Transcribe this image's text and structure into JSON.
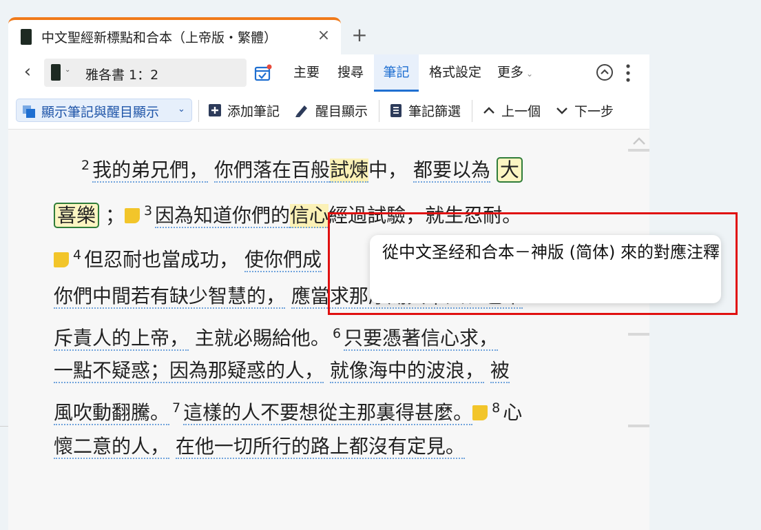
{
  "tab": {
    "title": "中文聖經新標點和合本（上帝版・繁體）",
    "close": "×",
    "new_tab": "+"
  },
  "toolbar": {
    "back": "‹",
    "reference_dropdown": "⌄",
    "reference": "雅各書 1：2",
    "menu": [
      "主要",
      "搜尋",
      "筆記",
      "格式設定",
      "更多"
    ],
    "more_chevron": "⌄",
    "active_menu": "筆記"
  },
  "subbar": {
    "show_notes": "顯示筆記與醒目顯示",
    "show_chevron": "⌄",
    "add_note": "添加筆記",
    "highlight": "醒目顯示",
    "filter": "筆記篩選",
    "prev": "上一個",
    "next": "下一步"
  },
  "verses": {
    "v2_num": "2",
    "v2_a": "我的弟兄們，",
    "v2_b": "你們落在百般",
    "v2_c": "試煉",
    "v2_d": "中，",
    "v2_e": "都要以為",
    "v2_f": "大",
    "v2_g": "喜樂",
    "v2_h": "；",
    "v3_num": "3",
    "v3_a": "因為知道你們的",
    "v3_b": "信心",
    "v3_c": "經過試驗，就生忍耐。",
    "v4_num": "4",
    "v4_a": "但忍耐也當成功，",
    "v4_b": "使你們成",
    "l4_a": "你們中間若有缺少智慧的，",
    "l4_b": "應當求那厚賜與眾人、也不",
    "l5_a": "斥責人的上帝，",
    "l5_b": "主就必賜給他。",
    "v6_num": "6",
    "l5_c": "只要憑著信心求，",
    "l6_a": "一點不疑惑；因為那疑惑的人，",
    "l6_b": "就像海中的波浪，",
    "l6_c": "被",
    "l7_a": "風吹動翻騰。",
    "v7_num": "7",
    "l7_b": "這樣的人不要想從主那裏得甚麼。",
    "v8_num": "8",
    "l7_c": "心",
    "l8_a": "懷二意的人，",
    "l8_b": "在他一切所行的路上都沒有定見。"
  },
  "tooltip": {
    "text": "從中文圣经和合本－神版 (简体) 來的對應注釋"
  },
  "colors": {
    "accent": "#1f6fd1",
    "tab_top": "#f07a1a",
    "highlight": "#fbf1b6",
    "box_border": "#2f7d3a",
    "annotation_red": "#e01010",
    "note_yellow": "#f2c52a"
  }
}
